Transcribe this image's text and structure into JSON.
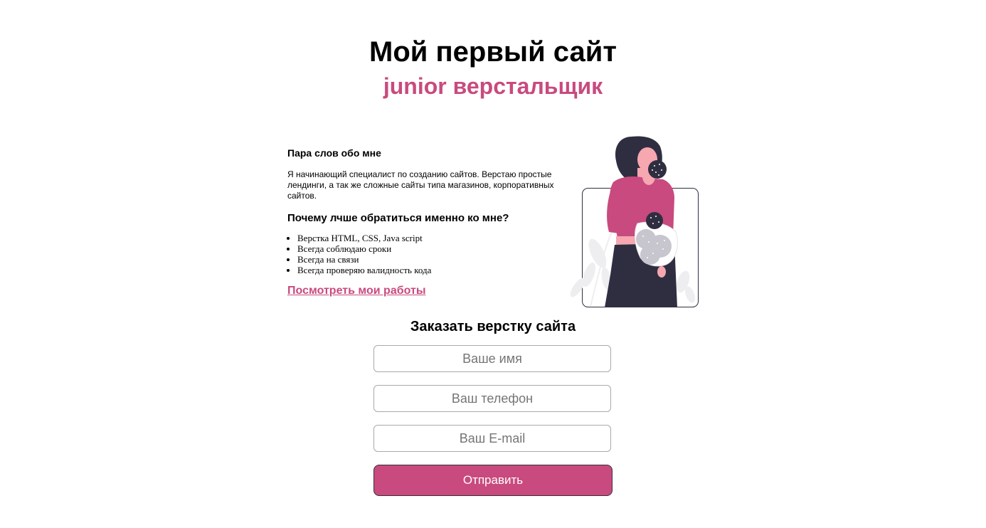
{
  "header": {
    "title": "Мой первый сайт",
    "subtitle": "junior верстальщик"
  },
  "about": {
    "heading": "Пара слов обо мне",
    "text": "Я начинающий специалист по созданию сайтов. Верстаю простые лендинги, а так же сложные сайты типа магазинов, корпоративных сайтов.",
    "why_heading": "Почему лчше обратиться именно ко мне?",
    "points": [
      "Верстка HTML, CSS, Java script",
      "Всегда соблюдаю сроки",
      "Всегда на связи",
      "Всегда проверяю валидность кода"
    ],
    "works_link": "Посмотреть мои работы"
  },
  "illustration": {
    "icon": "woman-with-flowers-illustration"
  },
  "order_form": {
    "heading": "Заказать верстку сайта",
    "name_placeholder": "Ваше имя",
    "phone_placeholder": "Ваш телефон",
    "email_placeholder": "Ваш E-mail",
    "submit_label": "Отправить"
  },
  "colors": {
    "accent": "#c94a7e",
    "dark": "#2f2e41"
  }
}
